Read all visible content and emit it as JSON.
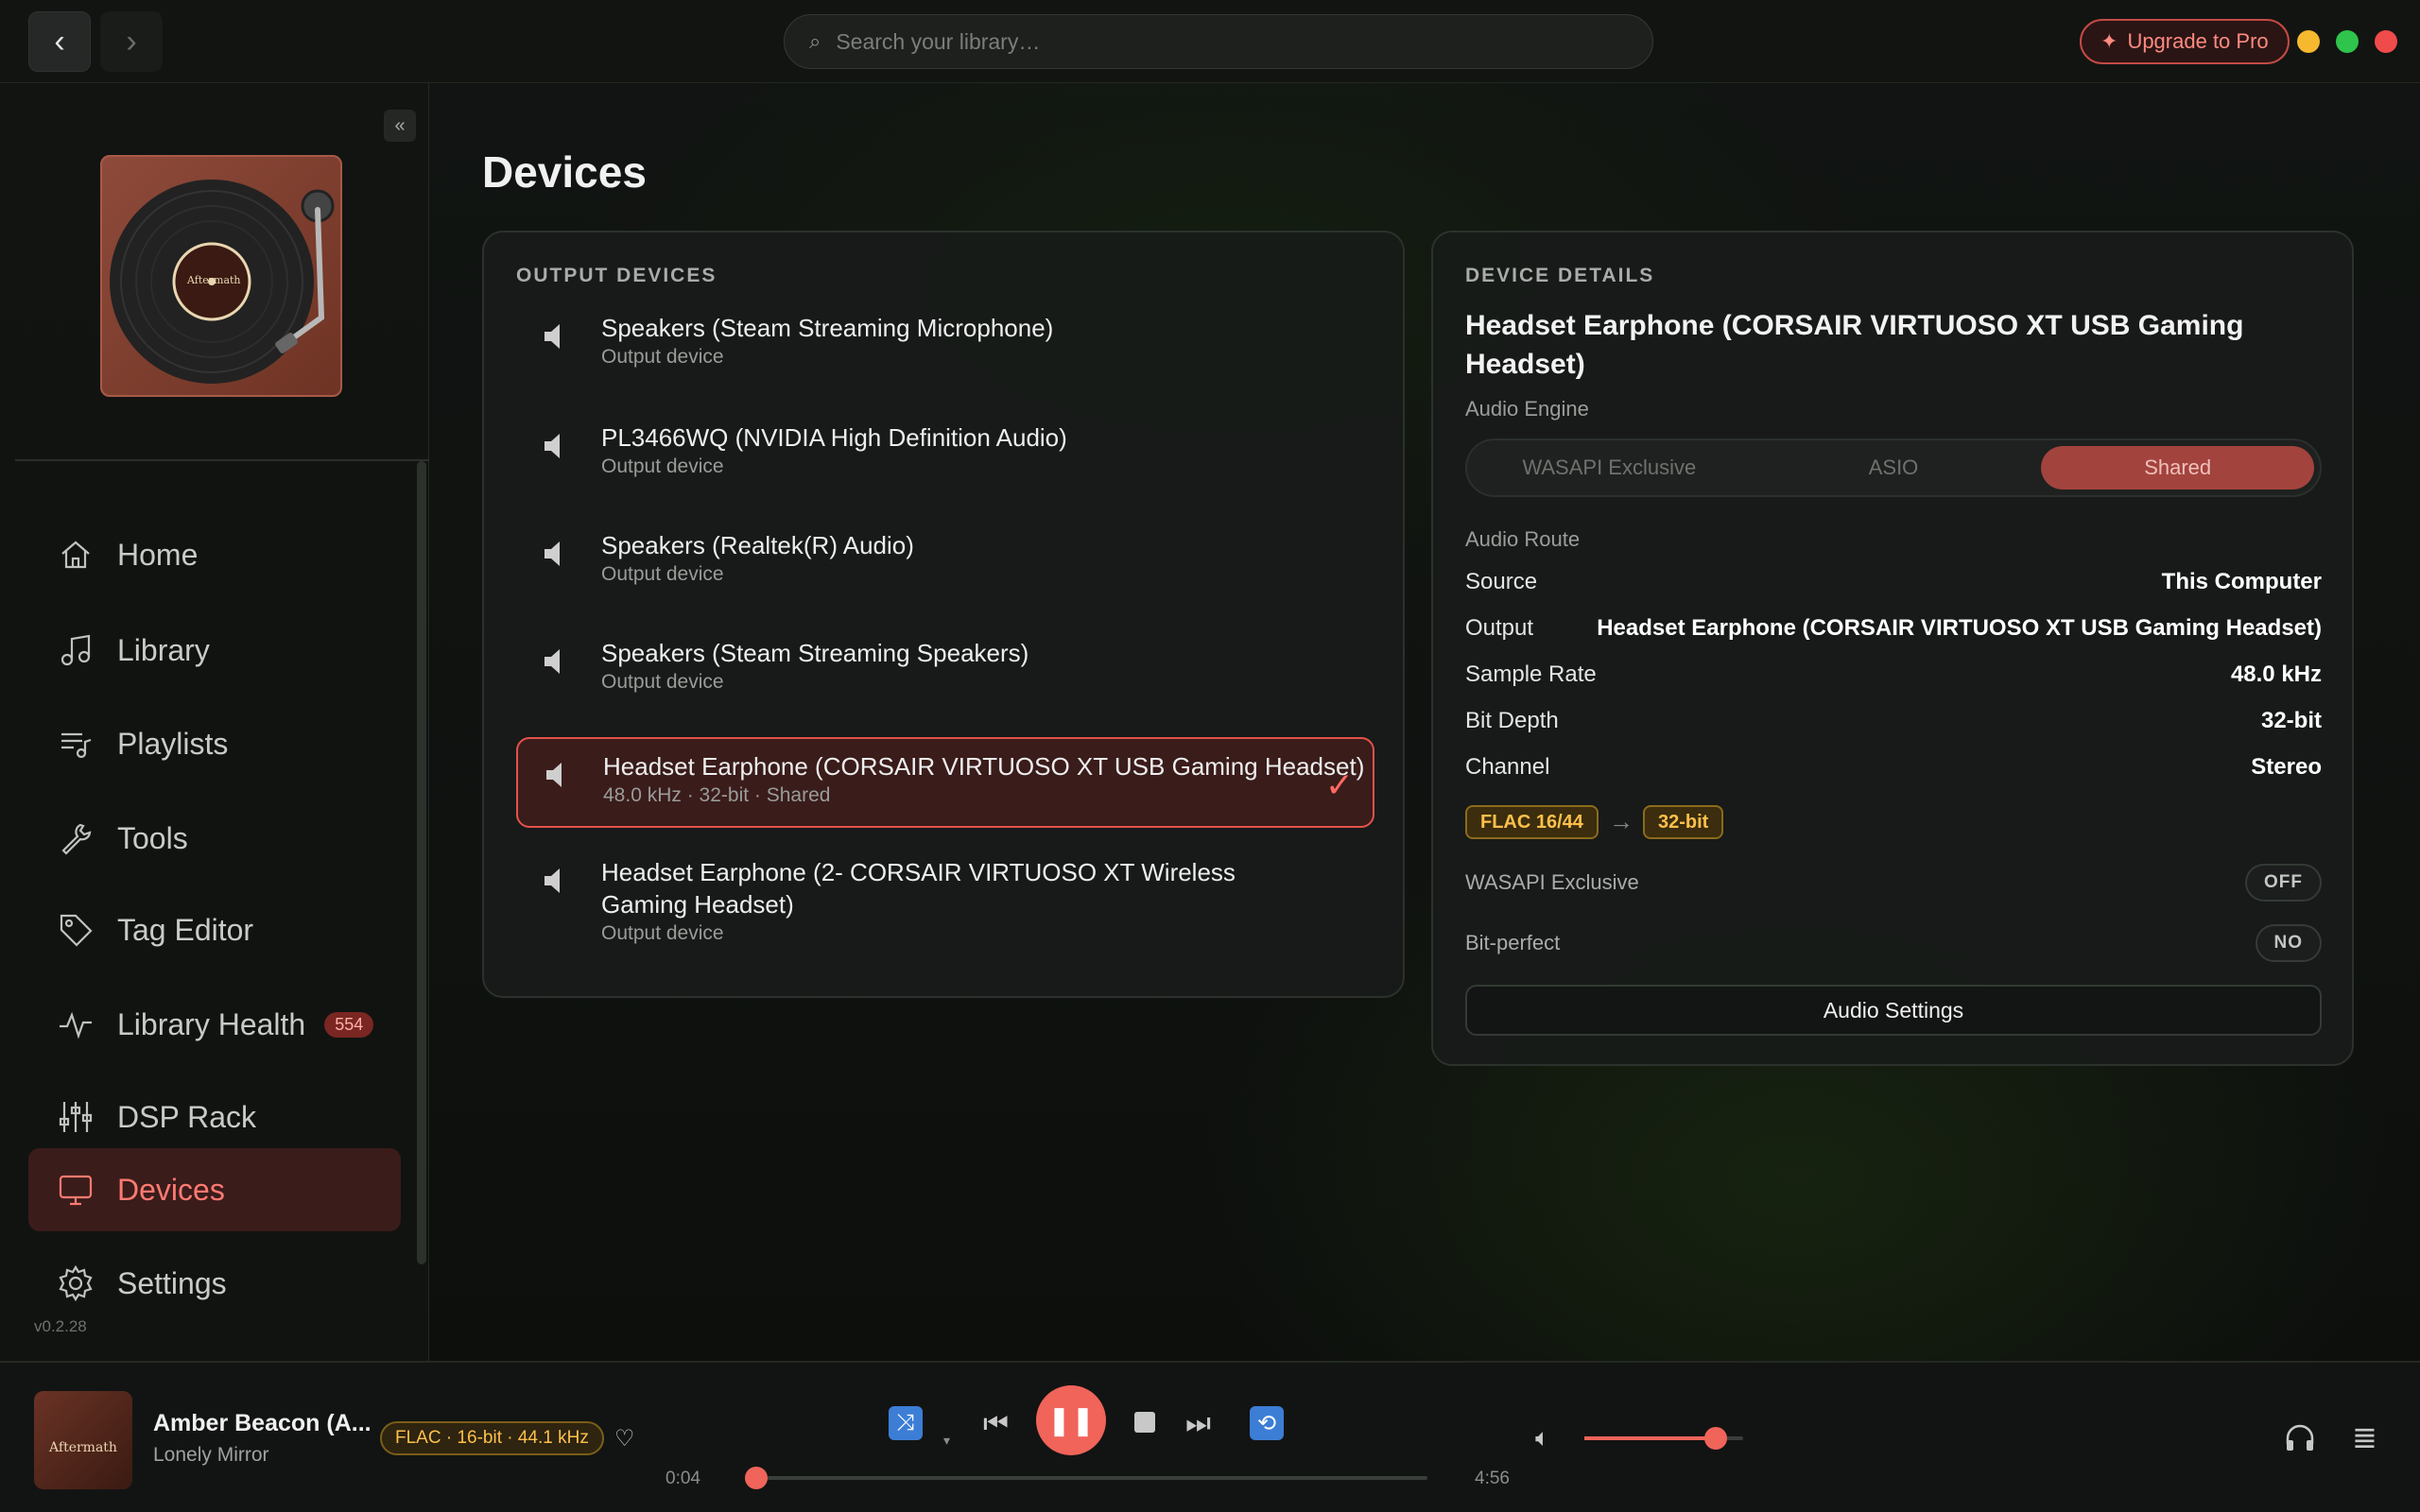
{
  "topbar": {
    "back_label": "‹",
    "forward_label": "›",
    "search_placeholder": "Search your library…",
    "upgrade_label": "Upgrade to Pro"
  },
  "sidebar": {
    "collapse_label": "«",
    "album_text": "Aftermath",
    "items": [
      {
        "label": "Home",
        "icon": "home-icon"
      },
      {
        "label": "Library",
        "icon": "music-note-icon"
      },
      {
        "label": "Playlists",
        "icon": "playlist-icon"
      },
      {
        "label": "Tools",
        "icon": "wrench-icon"
      },
      {
        "label": "Tag Editor",
        "icon": "tag-icon"
      },
      {
        "label": "Library Health",
        "icon": "pulse-icon",
        "badge": "554"
      },
      {
        "label": "DSP Rack",
        "icon": "sliders-icon"
      },
      {
        "label": "Devices",
        "icon": "monitor-icon",
        "active": true
      },
      {
        "label": "Settings",
        "icon": "gear-icon"
      }
    ],
    "version": "v0.2.28"
  },
  "main": {
    "title": "Devices",
    "output_devices": {
      "heading": "OUTPUT DEVICES",
      "devices": [
        {
          "name": "Speakers (Steam Streaming Microphone)",
          "sub": "Output device"
        },
        {
          "name": "PL3466WQ (NVIDIA High Definition Audio)",
          "sub": "Output device"
        },
        {
          "name": "Speakers (Realtek(R) Audio)",
          "sub": "Output device"
        },
        {
          "name": "Speakers (Steam Streaming Speakers)",
          "sub": "Output device"
        },
        {
          "name": "Headset Earphone (CORSAIR VIRTUOSO XT USB Gaming Headset)",
          "sub": "48.0 kHz · 32-bit · Shared",
          "selected": true
        },
        {
          "name": "Headset Earphone (2- CORSAIR VIRTUOSO XT Wireless Gaming Headset)",
          "sub": "Output device"
        }
      ]
    },
    "details": {
      "heading": "DEVICE DETAILS",
      "device_name": "Headset Earphone (CORSAIR VIRTUOSO XT USB Gaming Headset)",
      "audio_engine_label": "Audio Engine",
      "engine_options": [
        "WASAPI Exclusive",
        "ASIO",
        "Shared"
      ],
      "engine_selected": "Shared",
      "audio_route_label": "Audio Route",
      "route": [
        {
          "key": "Source",
          "value": "This Computer"
        },
        {
          "key": "Output",
          "value": "Headset Earphone (CORSAIR VIRTUOSO XT USB Gaming Headset)"
        },
        {
          "key": "Sample Rate",
          "value": "48.0 kHz"
        },
        {
          "key": "Bit Depth",
          "value": "32-bit"
        },
        {
          "key": "Channel",
          "value": "Stereo"
        }
      ],
      "chip_from": "FLAC 16/44",
      "chip_arrow": "→",
      "chip_to": "32-bit",
      "wasapi_exclusive_label": "WASAPI Exclusive",
      "wasapi_exclusive_value": "OFF",
      "bit_perfect_label": "Bit-perfect",
      "bit_perfect_value": "NO",
      "settings_button": "Audio Settings"
    }
  },
  "player": {
    "album_text": "Aftermath",
    "title": "Amber Beacon (A...",
    "artist": "Lonely Mirror",
    "format": "FLAC · 16-bit · 44.1 kHz",
    "time_current": "0:04",
    "time_total": "4:56",
    "progress_fraction": 0.014,
    "volume_fraction": 0.83
  },
  "colors": {
    "accent": "#f0645a",
    "active_bg": "#3a1c1b",
    "chip_gold": "#ffc04a",
    "shuffle_blue": "#3c7ed6"
  }
}
